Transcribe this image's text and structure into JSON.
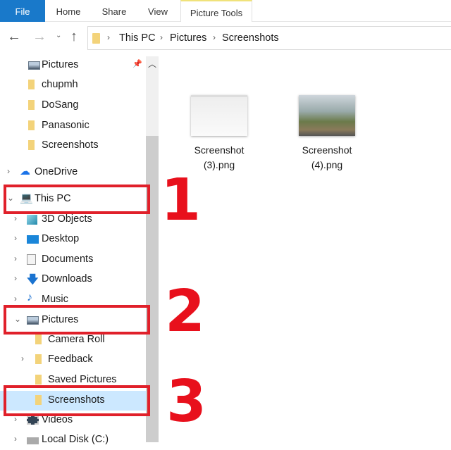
{
  "ribbon": {
    "tabs": [
      "File",
      "Home",
      "Share",
      "View",
      "Picture Tools"
    ]
  },
  "address": {
    "crumbs": [
      "This PC",
      "Pictures",
      "Screenshots"
    ]
  },
  "nav_pane": {
    "items": [
      {
        "label": "Pictures",
        "icon": "pictures-icon",
        "pinned": true
      },
      {
        "label": "chupmh",
        "icon": "folder-icon"
      },
      {
        "label": "DoSang",
        "icon": "folder-icon"
      },
      {
        "label": "Panasonic",
        "icon": "folder-icon"
      },
      {
        "label": "Screenshots",
        "icon": "folder-icon"
      },
      {
        "label": "OneDrive",
        "icon": "cloud-icon"
      },
      {
        "label": "This PC",
        "icon": "computer-icon"
      },
      {
        "label": "3D Objects",
        "icon": "cube-icon"
      },
      {
        "label": "Desktop",
        "icon": "desktop-icon"
      },
      {
        "label": "Documents",
        "icon": "document-icon"
      },
      {
        "label": "Downloads",
        "icon": "download-icon"
      },
      {
        "label": "Music",
        "icon": "music-icon"
      },
      {
        "label": "Pictures",
        "icon": "pictures-icon"
      },
      {
        "label": "Camera Roll",
        "icon": "folder-icon"
      },
      {
        "label": "Feedback",
        "icon": "folder-icon"
      },
      {
        "label": "Saved Pictures",
        "icon": "folder-icon"
      },
      {
        "label": "Screenshots",
        "icon": "folder-icon",
        "selected": true
      },
      {
        "label": "Videos",
        "icon": "video-icon"
      },
      {
        "label": "Local Disk (C:)",
        "icon": "drive-icon"
      }
    ]
  },
  "files": [
    {
      "line1": "Screenshot",
      "line2": "(3).png"
    },
    {
      "line1": "Screenshot",
      "line2": "(4).png"
    }
  ],
  "annotations": [
    "1",
    "2",
    "3"
  ],
  "colors": {
    "accent": "#1979ca",
    "selected": "#cce8ff",
    "annotation": "#e0202a"
  }
}
